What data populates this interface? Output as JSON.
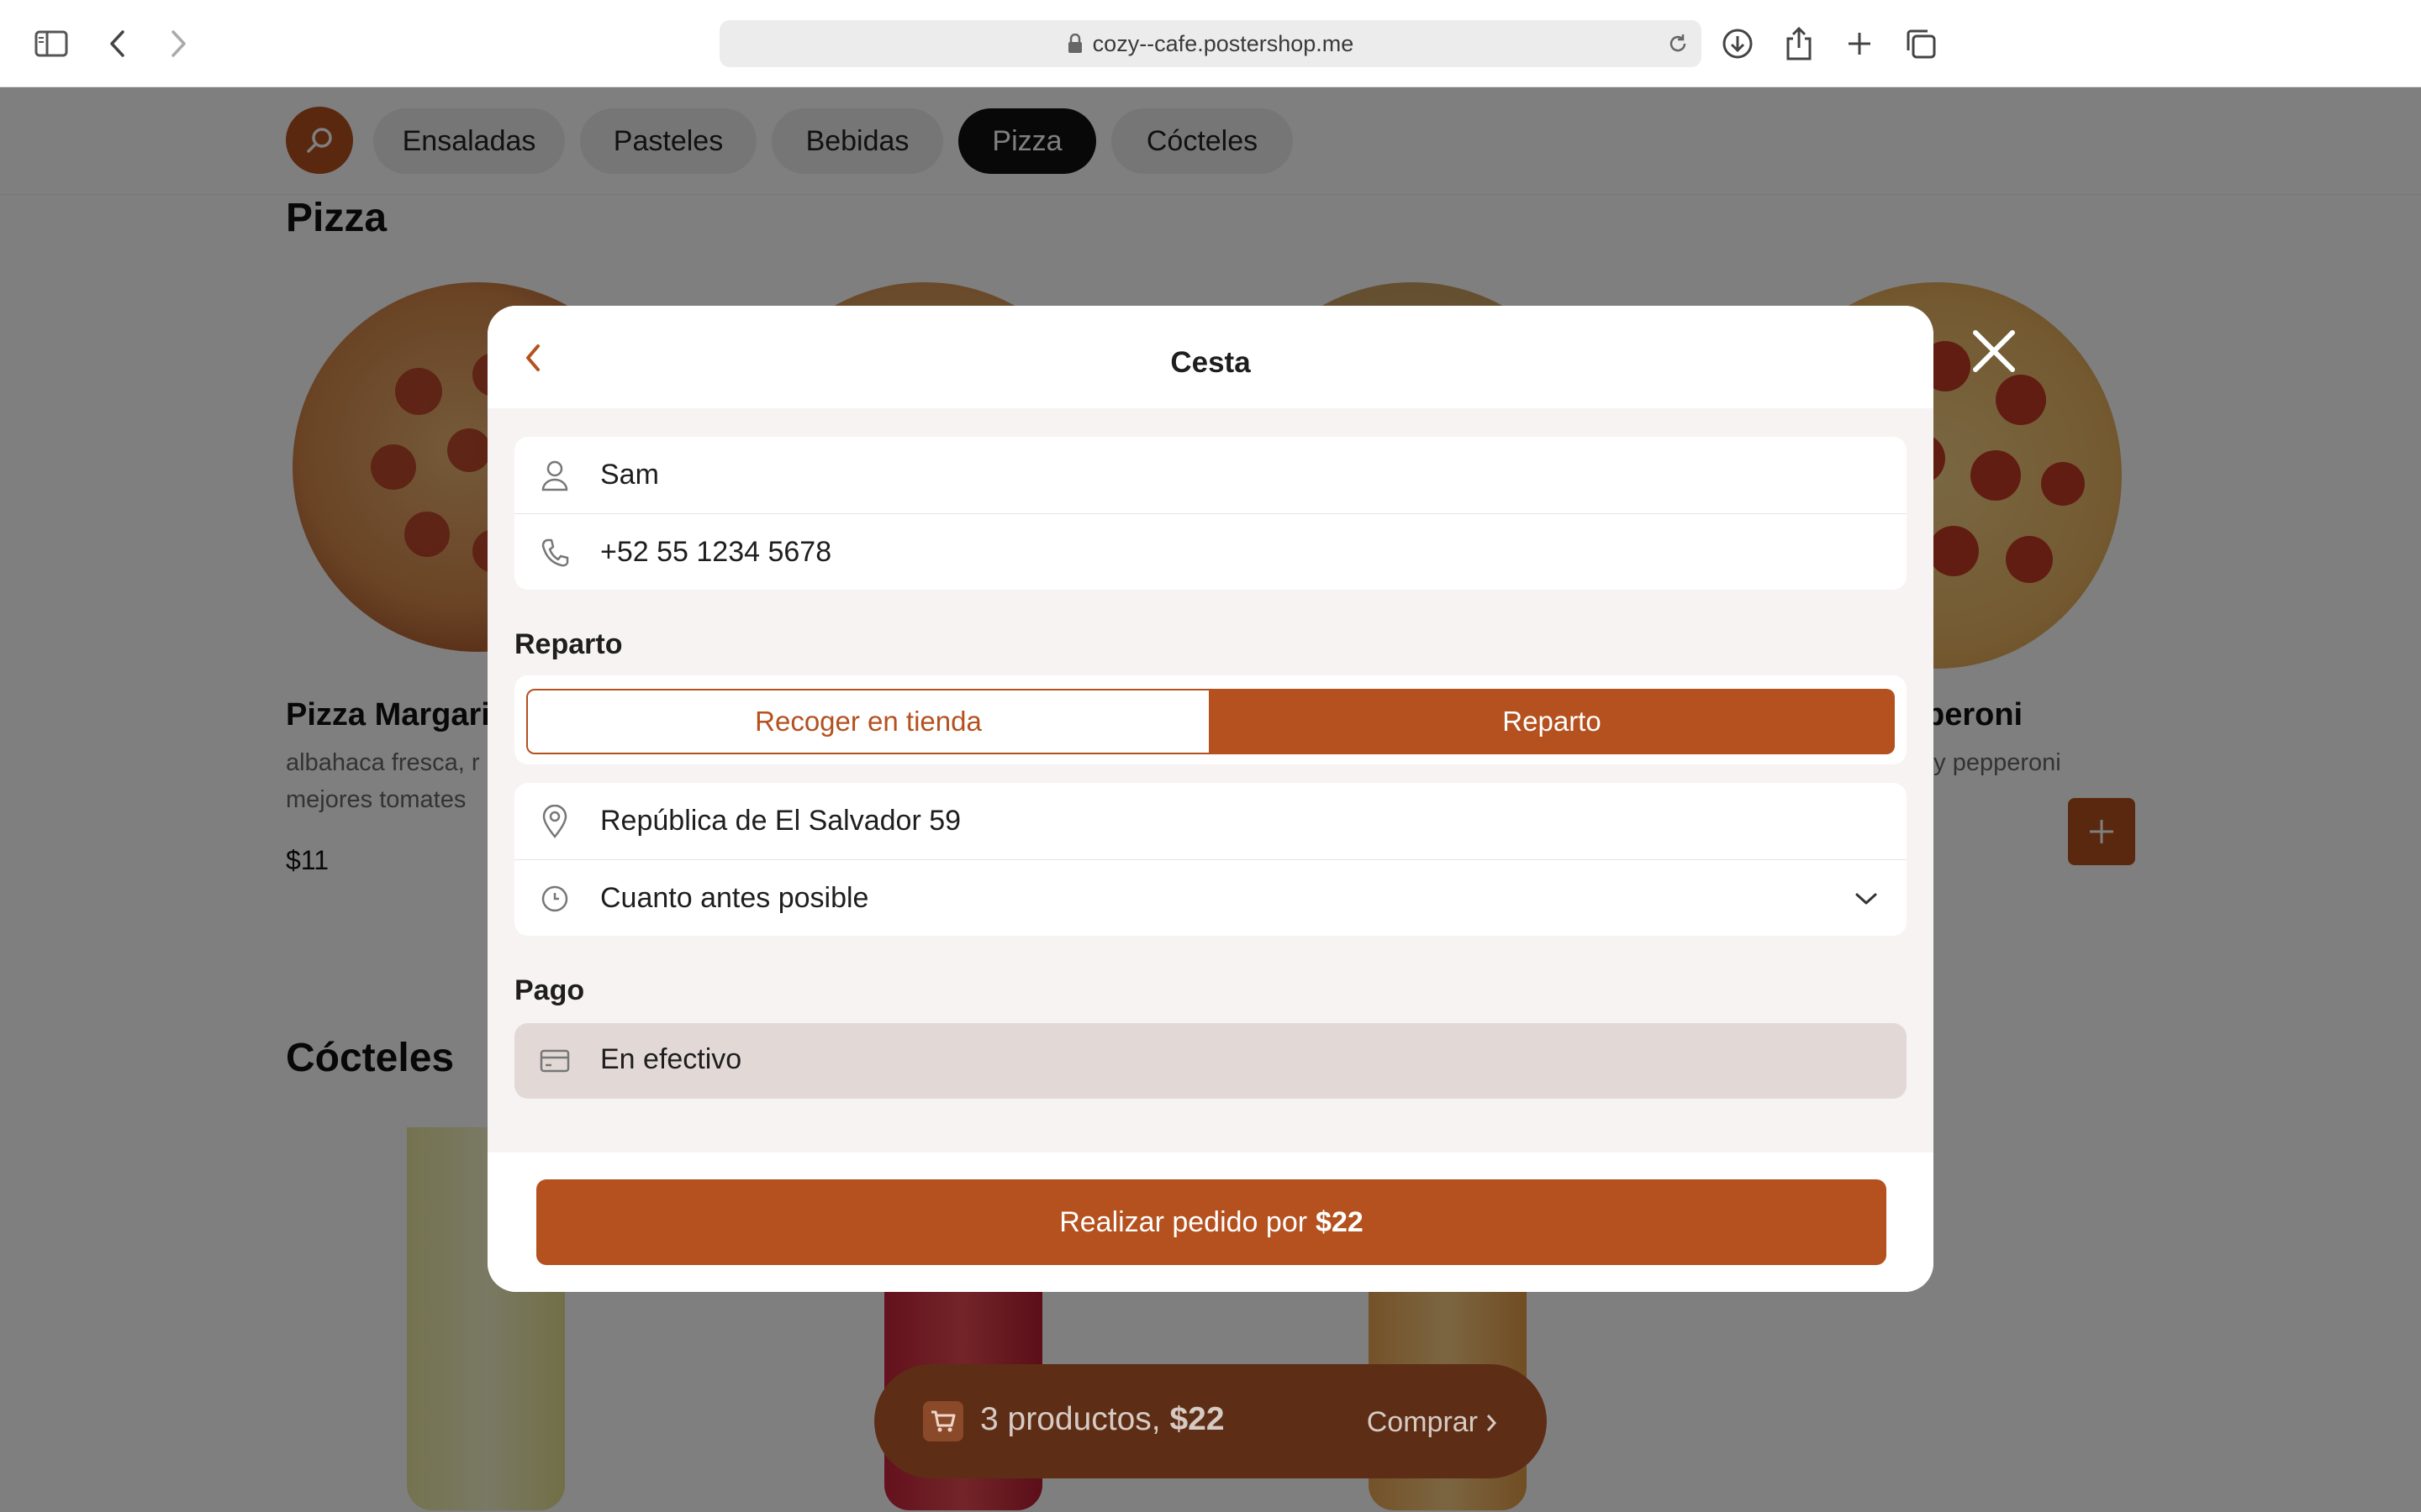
{
  "browser": {
    "url": "cozy--cafe.postershop.me"
  },
  "categories": {
    "items": [
      {
        "label": "Ensaladas"
      },
      {
        "label": "Pasteles"
      },
      {
        "label": "Bebidas"
      },
      {
        "label": "Pizza",
        "active": true
      },
      {
        "label": "Cócteles"
      }
    ]
  },
  "menu": {
    "pizza_title": "Pizza",
    "products": [
      {
        "name": "Pizza Margari",
        "desc_line1": "albahaca fresca, r",
        "desc_line2": "mejores tomates",
        "price": "$11"
      },
      {
        "name": "peroni",
        "desc_line1": "o y pepperoni"
      }
    ],
    "cocktails_title": "Cócteles"
  },
  "cart": {
    "count_text": "3 productos,",
    "total": "$22",
    "buy_label": "Comprar"
  },
  "modal": {
    "title": "Cesta",
    "name": "Sam",
    "phone": "+52 55 1234 5678",
    "delivery_label": "Reparto",
    "delivery_options": {
      "pickup": "Recoger en tienda",
      "delivery": "Reparto",
      "selected": "delivery"
    },
    "address": "República de El Salvador 59",
    "time": "Cuanto antes posible",
    "payment_label": "Pago",
    "payment": "En efectivo",
    "submit_prefix": "Realizar pedido por",
    "submit_amount": "$22"
  },
  "colors": {
    "accent": "#b4511f",
    "cart_bar": "#5e2d15",
    "active_chip": "#111111"
  }
}
